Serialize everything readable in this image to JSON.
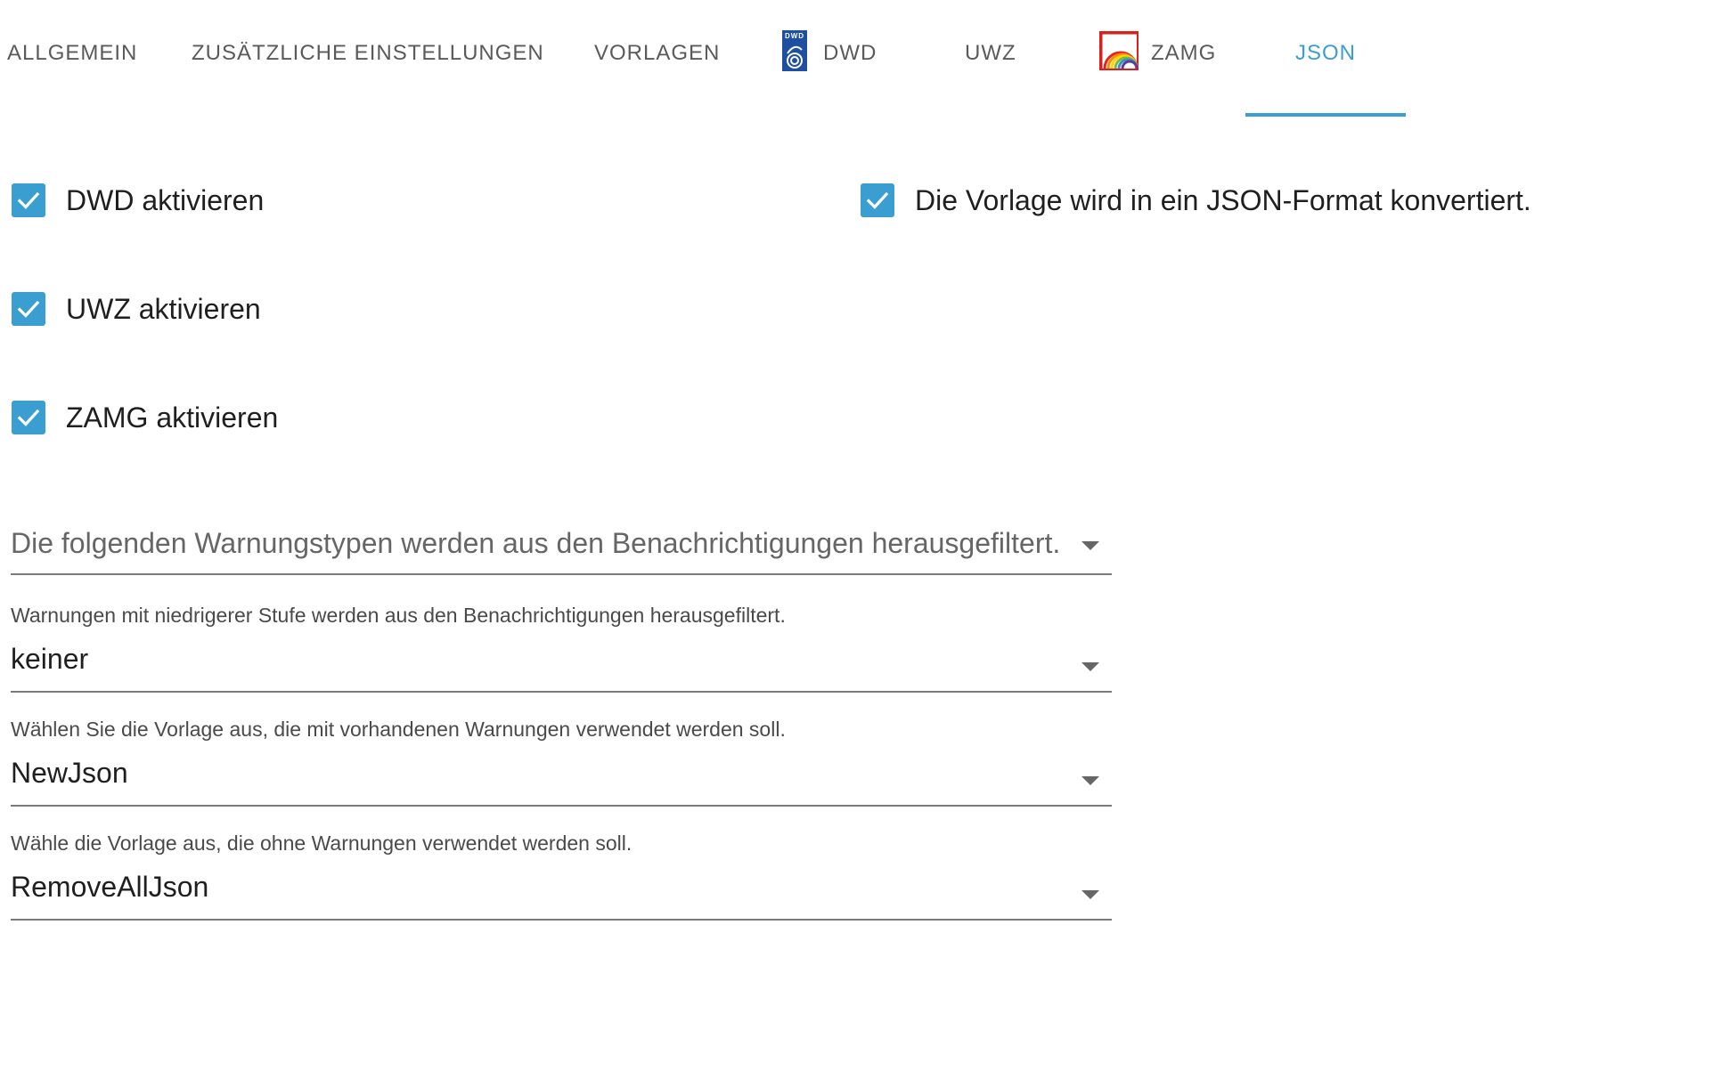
{
  "tabs": [
    {
      "label": "ALLGEMEIN"
    },
    {
      "label": "ZUSÄTZLICHE EINSTELLUNGEN"
    },
    {
      "label": "VORLAGEN"
    },
    {
      "label": "DWD",
      "icon": "dwd-logo-icon"
    },
    {
      "label": "UWZ"
    },
    {
      "label": "ZAMG",
      "icon": "zamg-logo-icon"
    },
    {
      "label": "JSON",
      "active": true
    }
  ],
  "dwd_logo_text": "DWD",
  "checkboxes": {
    "dwd": {
      "label": "DWD aktivieren",
      "checked": true
    },
    "uwz": {
      "label": "UWZ aktivieren",
      "checked": true
    },
    "zamg": {
      "label": "ZAMG aktivieren",
      "checked": true
    },
    "json": {
      "label": "Die Vorlage wird in ein JSON-Format konvertiert.",
      "checked": true
    }
  },
  "filter_select": {
    "placeholder": "Die folgenden Warnungstypen werden aus den Benachrichtigungen herausgefiltert."
  },
  "level_select": {
    "helper": "Warnungen mit niedrigerer Stufe werden aus den Benachrichtigungen herausgefiltert.",
    "value": "keiner"
  },
  "template_with_select": {
    "helper": "Wählen Sie die Vorlage aus, die mit vorhandenen Warnungen verwendet werden soll.",
    "value": "NewJson"
  },
  "template_without_select": {
    "helper": "Wähle die Vorlage aus, die ohne Warnungen verwendet werden soll.",
    "value": "RemoveAllJson"
  },
  "colors": {
    "accent": "#3a9fd0",
    "tab_text": "#5a5a5a",
    "dwd_blue": "#1e4fa0"
  }
}
